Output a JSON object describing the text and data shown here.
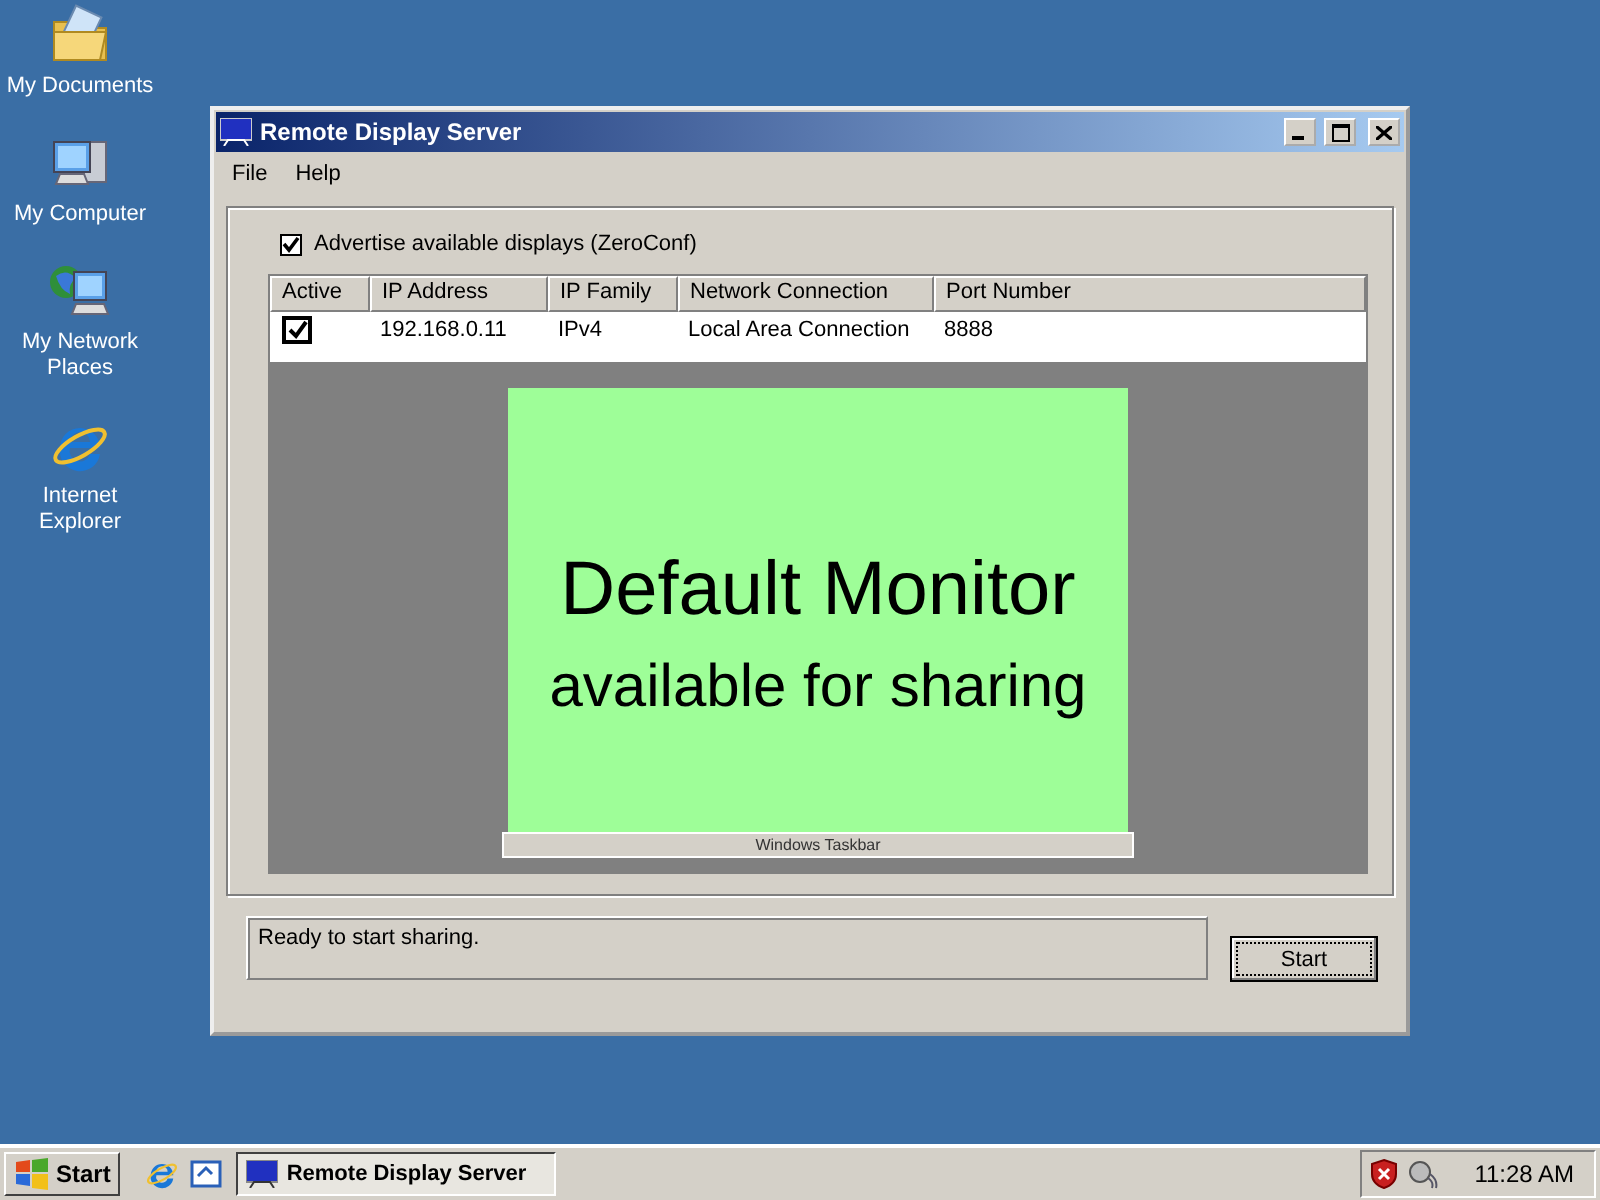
{
  "desktop_icons": [
    {
      "kind": "documents",
      "label": "My Documents"
    },
    {
      "kind": "computer",
      "label": "My Computer"
    },
    {
      "kind": "network",
      "label": "My Network Places"
    },
    {
      "kind": "browser",
      "label": "Internet Explorer"
    }
  ],
  "window": {
    "title": "Remote Display Server",
    "menu": [
      "File",
      "Help"
    ],
    "advertise": {
      "label": "Advertise available displays (ZeroConf)",
      "checked": true
    },
    "table": {
      "columns": [
        "Active",
        "IP Address",
        "IP Family",
        "Network Connection",
        "Port Number"
      ],
      "rows": [
        {
          "active": true,
          "cells": [
            "",
            "192.168.0.11",
            "IPv4",
            "Local Area Connection",
            "8888"
          ]
        }
      ]
    },
    "preview": {
      "title": "Default Monitor",
      "subtitle": "available for sharing",
      "taskbar_label": "Windows Taskbar"
    },
    "status": "Ready to start sharing.",
    "button": "Start"
  },
  "taskbar": {
    "start": "Start",
    "tasks": [
      {
        "label": "Remote Display Server",
        "selected": true
      }
    ],
    "clock": "11:28 AM"
  }
}
